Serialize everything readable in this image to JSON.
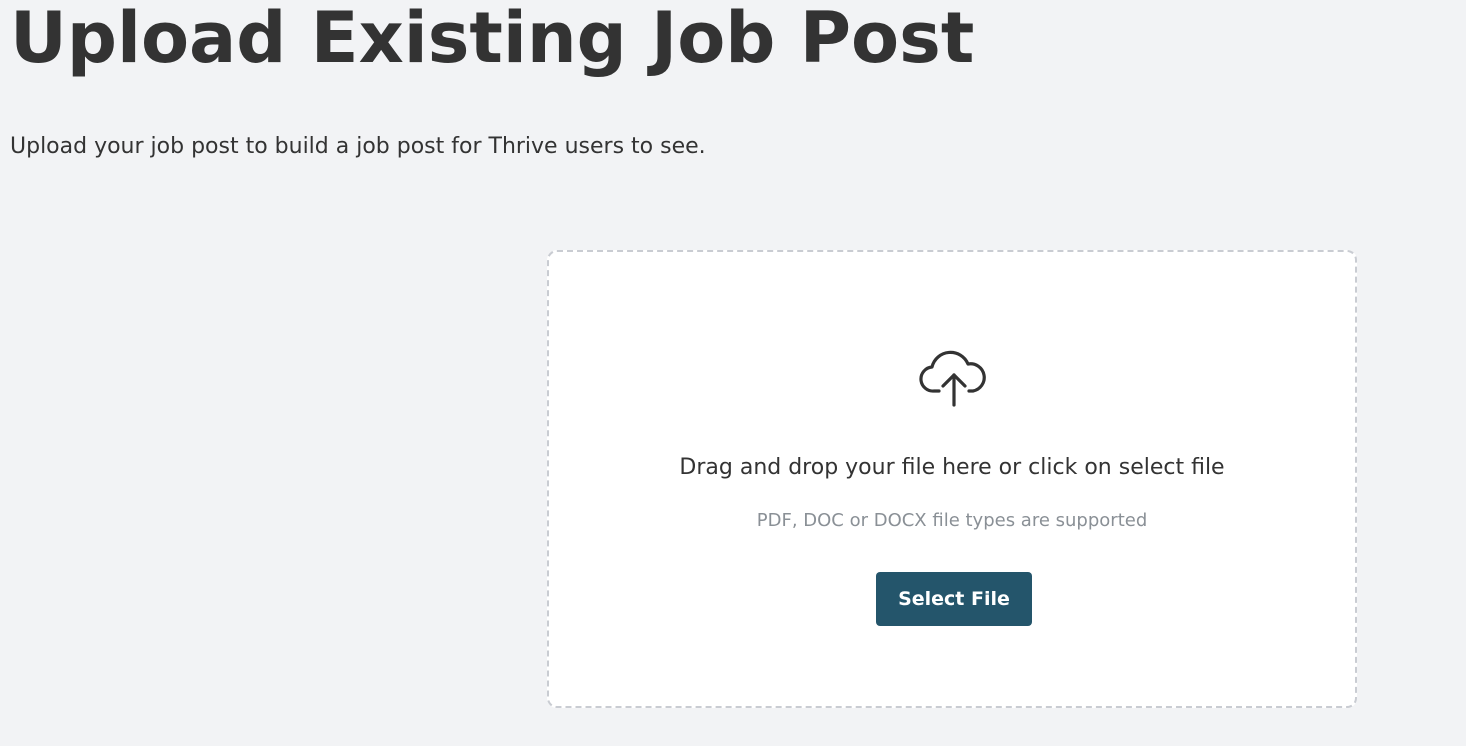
{
  "header": {
    "title": "Upload Existing Job Post",
    "subtitle": "Upload your job post to build a job post for Thrive users to see."
  },
  "dropzone": {
    "icon": "cloud-upload-icon",
    "instruction": "Drag and drop your file here or click on select file",
    "supported_types": "PDF, DOC or DOCX file types are supported",
    "button_label": "Select File"
  },
  "colors": {
    "background": "#f2f3f5",
    "button": "#24556b",
    "dropzone_border": "#c9ccd2",
    "muted_text": "#8a9096"
  }
}
